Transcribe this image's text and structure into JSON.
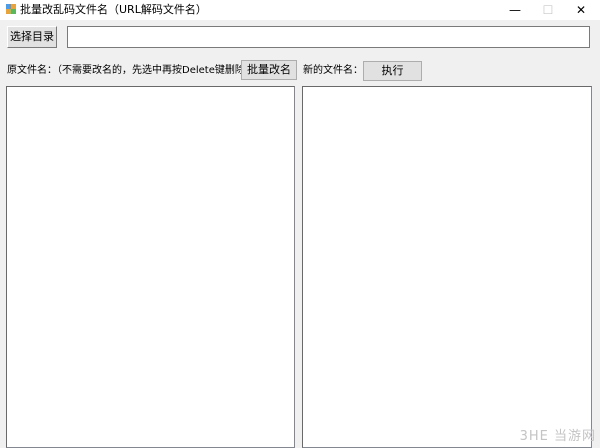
{
  "window": {
    "title": "批量改乱码文件名（URL解码文件名）",
    "minimize": "—",
    "maximize": "☐",
    "close": "✕"
  },
  "toolbar": {
    "select_dir_label": "选择目录",
    "path_value": ""
  },
  "labels": {
    "original_names": "原文件名：（不需要改名的，先选中再按Delete键删除）",
    "batch_rename": "批量改名",
    "new_names": "新的文件名：",
    "execute": "执行"
  },
  "lists": {
    "original_items": [],
    "new_items": []
  },
  "watermark": "3HE 当游网"
}
